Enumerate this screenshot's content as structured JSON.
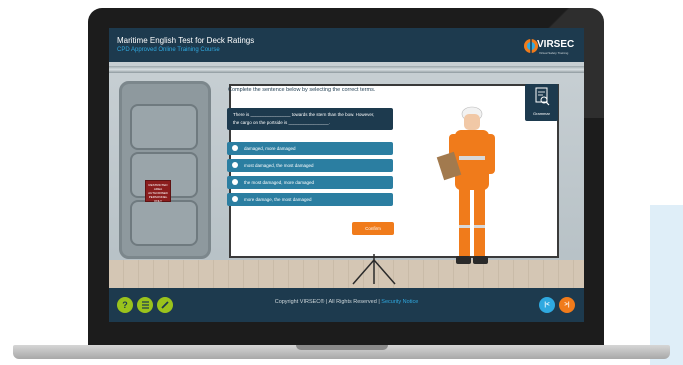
{
  "app": {
    "title": "Maritime English Test for Deck Ratings",
    "subtitle": "CPD Approved Online Training Course",
    "logo_text": "VIRSEC",
    "logo_subtext": "Virtual Safety Training"
  },
  "question": {
    "instruction": "Complete the sentence below by selecting the correct terms.",
    "line1": "There is ________________ towards the stern than the bow. However,",
    "line2": "the cargo on the portside is ________________."
  },
  "options": [
    {
      "label": "damaged, more damaged"
    },
    {
      "label": "most damaged, the most damaged"
    },
    {
      "label": "the most damaged, more damaged"
    },
    {
      "label": "more damage, the most damaged"
    }
  ],
  "confirm_label": "Confirm",
  "glossary_label": "Grammar",
  "door_sign": "RESTRICTED AREA AUTHORISED PERSONNEL ONLY",
  "footer": {
    "copyright": "Copyright VIRSEC® | All Rights Reserved | ",
    "security_link": "Security Notice",
    "help_symbol": "?",
    "prev_symbol": "|<",
    "next_symbol": ">|"
  },
  "colors": {
    "navy": "#1d3a4e",
    "option_blue": "#2b7ea1",
    "accent_orange": "#f07b1b",
    "help_yellow": "#9ac31c",
    "prev_blue": "#2fa9e0"
  }
}
